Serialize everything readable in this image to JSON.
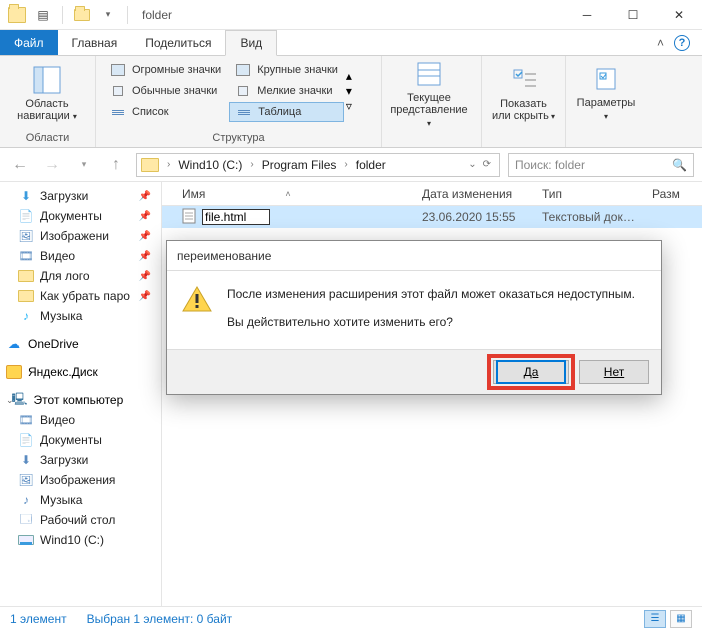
{
  "window": {
    "title": "folder"
  },
  "tabs": {
    "file": "Файл",
    "home": "Главная",
    "share": "Поделиться",
    "view": "Вид"
  },
  "ribbon": {
    "group_regions": {
      "nav_pane": "Область навигации",
      "label": "Области"
    },
    "group_layout": {
      "label": "Структура",
      "huge": "Огромные значки",
      "large": "Крупные значки",
      "medium": "Обычные значки",
      "small": "Мелкие значки",
      "list": "Список",
      "table": "Таблица"
    },
    "group_current": {
      "btn": "Текущее представление"
    },
    "group_show": {
      "btn": "Показать или скрыть"
    },
    "group_params": {
      "btn": "Параметры"
    }
  },
  "address": {
    "crumbs": [
      "Wind10 (C:)",
      "Program Files",
      "folder"
    ]
  },
  "search": {
    "placeholder": "Поиск: folder"
  },
  "sidebar": {
    "quick": [
      {
        "label": "Загрузки",
        "icon": "download",
        "pin": true
      },
      {
        "label": "Документы",
        "icon": "doc",
        "pin": true
      },
      {
        "label": "Изображени",
        "icon": "pic",
        "pin": true
      },
      {
        "label": "Видео",
        "icon": "video",
        "pin": true
      },
      {
        "label": "Для лого",
        "icon": "folder",
        "pin": true
      },
      {
        "label": "Как убрать паро",
        "icon": "folder",
        "pin": true
      },
      {
        "label": "Музыка",
        "icon": "music",
        "pin": false
      }
    ],
    "onedrive": "OneDrive",
    "yadisk": "Яндекс.Диск",
    "thispc": {
      "head": "Этот компьютер",
      "items": [
        "Видео",
        "Документы",
        "Загрузки",
        "Изображения",
        "Музыка",
        "Рабочий стол",
        "Wind10 (C:)"
      ]
    }
  },
  "columns": {
    "name": "Имя",
    "date": "Дата изменения",
    "type": "Тип",
    "size": "Разм"
  },
  "file_row": {
    "name_value": "file.html",
    "date": "23.06.2020 15:55",
    "type": "Текстовый докум..."
  },
  "dialog": {
    "title": "переименование",
    "line1": "После изменения расширения этот файл может оказаться недоступным.",
    "line2": "Вы действительно хотите изменить его?",
    "yes": "Да",
    "no": "Нет"
  },
  "status": {
    "count": "1 элемент",
    "selected": "Выбран 1 элемент: 0 байт"
  }
}
